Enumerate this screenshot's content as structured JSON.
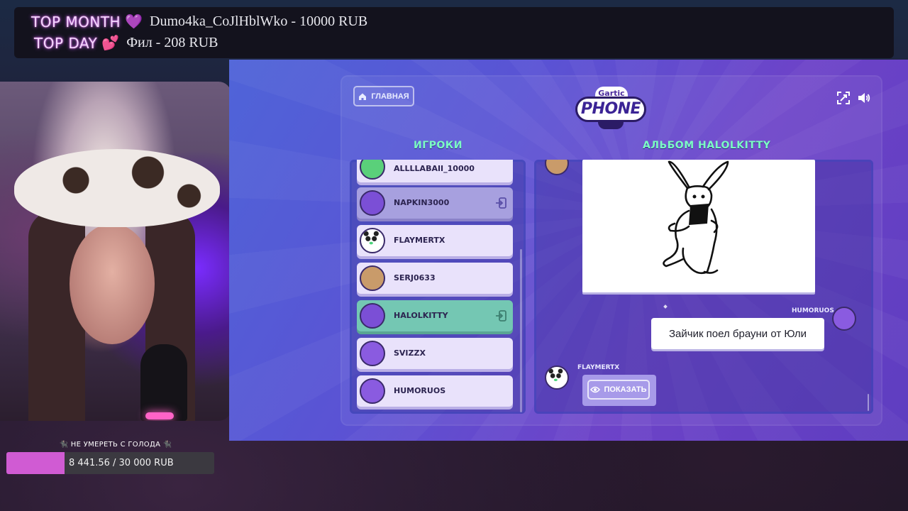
{
  "overlay": {
    "top_month_label": "TOP MONTH",
    "top_month_value": "Dumo4ka_CoJlHblWko - 10000 RUB",
    "top_day_label": "TOP DAY",
    "top_day_value": "Фил - 208 RUB",
    "heart_icon": "heart-icon",
    "double_heart_icon": "double-heart-icon"
  },
  "donation_goal": {
    "title": "🐈‍⬛ НЕ УМЕРЕТЬ С ГОЛОДА 🐈‍⬛",
    "progress_text": "8 441.56 / 30 000 RUB",
    "current": 8441.56,
    "target": 30000,
    "fill_color": "#d05bd3"
  },
  "game": {
    "home_label": "ГЛАВНАЯ",
    "logo_small": "Gartic",
    "logo_big": "PHONE",
    "players_title": "ИГРОКИ",
    "album_title": "АЛЬБОМ HALOLKITTY",
    "players": [
      {
        "name": "ALLLLABAII_10000",
        "state": "normal",
        "avatar": "green-frog-avatar",
        "exit": false
      },
      {
        "name": "NAPKIN3000",
        "state": "inactive",
        "avatar": "purple-bird-avatar",
        "exit": true
      },
      {
        "name": "FLAYMERTX",
        "state": "normal",
        "avatar": "panda-avatar",
        "exit": false
      },
      {
        "name": "SERJ0633",
        "state": "normal",
        "avatar": "deer-avatar",
        "exit": false
      },
      {
        "name": "HALOLKITTY",
        "state": "current",
        "avatar": "purple-bird-avatar",
        "exit": true
      },
      {
        "name": "SVIZZX",
        "state": "normal",
        "avatar": "purple-bird-avatar",
        "exit": false
      },
      {
        "name": "HUMORUOS",
        "state": "normal",
        "avatar": "purple-bird-avatar",
        "exit": false
      }
    ],
    "album": {
      "reply_author": "HUMORUOS",
      "reply_text": "Зайчик поел брауни от Юли",
      "next_author": "FLAYMERTX",
      "show_label": "ПОКАЗАТЬ"
    },
    "colors": {
      "title_green": "#7cfbc4",
      "current_player": "#74c7b3",
      "inactive_player": "#a7a0df"
    }
  }
}
